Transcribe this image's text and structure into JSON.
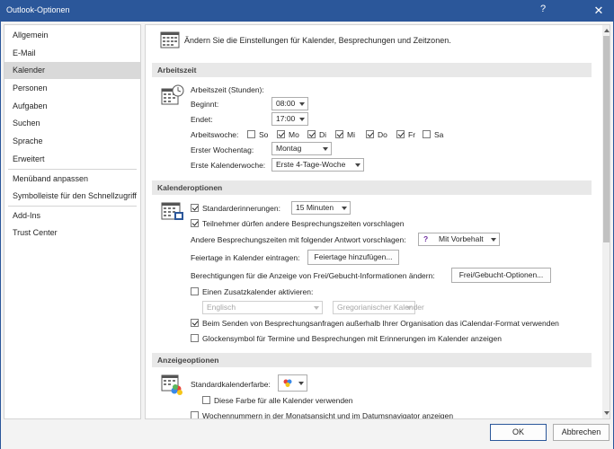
{
  "window": {
    "title": "Outlook-Optionen",
    "help": "?",
    "close": "✕"
  },
  "sidebar": {
    "items": [
      {
        "label": "Allgemein"
      },
      {
        "label": "E-Mail"
      },
      {
        "label": "Kalender",
        "selected": true
      },
      {
        "label": "Personen"
      },
      {
        "label": "Aufgaben"
      },
      {
        "label": "Suchen"
      },
      {
        "label": "Sprache"
      },
      {
        "label": "Erweitert"
      },
      {
        "label": "Menüband anpassen"
      },
      {
        "label": "Symbolleiste für den Schnellzugriff"
      },
      {
        "label": "Add-Ins"
      },
      {
        "label": "Trust Center"
      }
    ]
  },
  "main": {
    "intro": "Ändern Sie die Einstellungen für Kalender, Besprechungen und Zeitzonen.",
    "arbeitszeit": {
      "header": "Arbeitszeit",
      "label": "Arbeitszeit (Stunden):",
      "beginn_label": "Beginnt:",
      "beginn_value": "08:00",
      "ende_label": "Endet:",
      "ende_value": "17:00",
      "woche_label": "Arbeitswoche:",
      "days": [
        {
          "label": "So",
          "checked": false
        },
        {
          "label": "Mo",
          "checked": true
        },
        {
          "label": "Di",
          "checked": true
        },
        {
          "label": "Mi",
          "checked": true
        },
        {
          "label": "Do",
          "checked": true
        },
        {
          "label": "Fr",
          "checked": true
        },
        {
          "label": "Sa",
          "checked": false
        }
      ],
      "erster_tag_label": "Erster Wochentag:",
      "erster_tag_value": "Montag",
      "erste_woche_label": "Erste Kalenderwoche:",
      "erste_woche_value": "Erste 4-Tage-Woche"
    },
    "kalenderoptionen": {
      "header": "Kalenderoptionen",
      "erinnerung_label": "Standarderinnerungen:",
      "erinnerung_value": "15 Minuten",
      "teilnehmer_label": "Teilnehmer dürfen andere Besprechungszeiten vorschlagen",
      "antwort_label": "Andere Besprechungszeiten mit folgender Antwort vorschlagen:",
      "antwort_value": "Mit Vorbehalt",
      "feiertage_label": "Feiertage in Kalender eintragen:",
      "feiertage_button": "Feiertage hinzufügen...",
      "frei_label": "Berechtigungen für die Anzeige von Frei/Gebucht-Informationen ändern:",
      "frei_button": "Frei/Gebucht-Optionen...",
      "zusatz_label": "Einen Zusatzkalender aktivieren:",
      "zusatz_sprache": "Englisch",
      "zusatz_kalender": "Gregorianischer Kalender",
      "icalendar_label": "Beim Senden von Besprechungsanfragen außerhalb Ihrer Organisation das iCalendar-Format verwenden",
      "glocke_label": "Glockensymbol für Termine und Besprechungen mit Erinnerungen im Kalender anzeigen"
    },
    "anzeigeoptionen": {
      "header": "Anzeigeoptionen",
      "farbe_label": "Standardkalenderfarbe:",
      "diese_farbe_label": "Diese Farbe für alle Kalender verwenden",
      "wochennummern_label": "Wochennummern in der Monatsansicht und im Datumsnavigator anzeigen"
    }
  },
  "footer": {
    "ok": "OK",
    "cancel": "Abbrechen"
  },
  "colors": {
    "titlebar": "#2b579a",
    "selection": "#d9d9d9",
    "section": "#e8e8e8"
  }
}
